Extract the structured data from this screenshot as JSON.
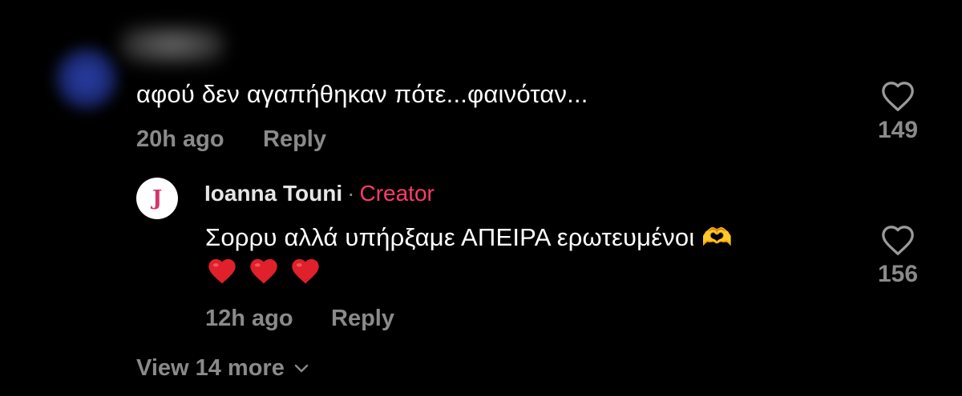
{
  "colors": {
    "background": "#000000",
    "text": "#ffffff",
    "muted": "#8a8a8a",
    "creator_accent": "#ff3b6b",
    "heart_emoji": "#e0202a"
  },
  "comments": [
    {
      "author": "",
      "avatar": "blurred-avatar",
      "text": "αφού δεν αγαπήθηκαν πότε...φαινόταν...",
      "time": "20h ago",
      "reply_label": "Reply",
      "likes": "149",
      "like_icon": "heart-outline-icon"
    }
  ],
  "reply": {
    "avatar_letter": "J",
    "author": "Ioanna Touni",
    "separator": "·",
    "badge": "Creator",
    "text": "Σορρυ αλλά υπήρξαμε ΑΠΕΙΡΑ ερωτευμένοι 🫶",
    "emojis": [
      "red-heart-emoji",
      "red-heart-emoji",
      "red-heart-emoji"
    ],
    "time": "12h ago",
    "reply_label": "Reply",
    "likes": "156",
    "like_icon": "heart-outline-icon"
  },
  "view_more": {
    "label": "View 14 more",
    "icon": "chevron-down-icon"
  }
}
